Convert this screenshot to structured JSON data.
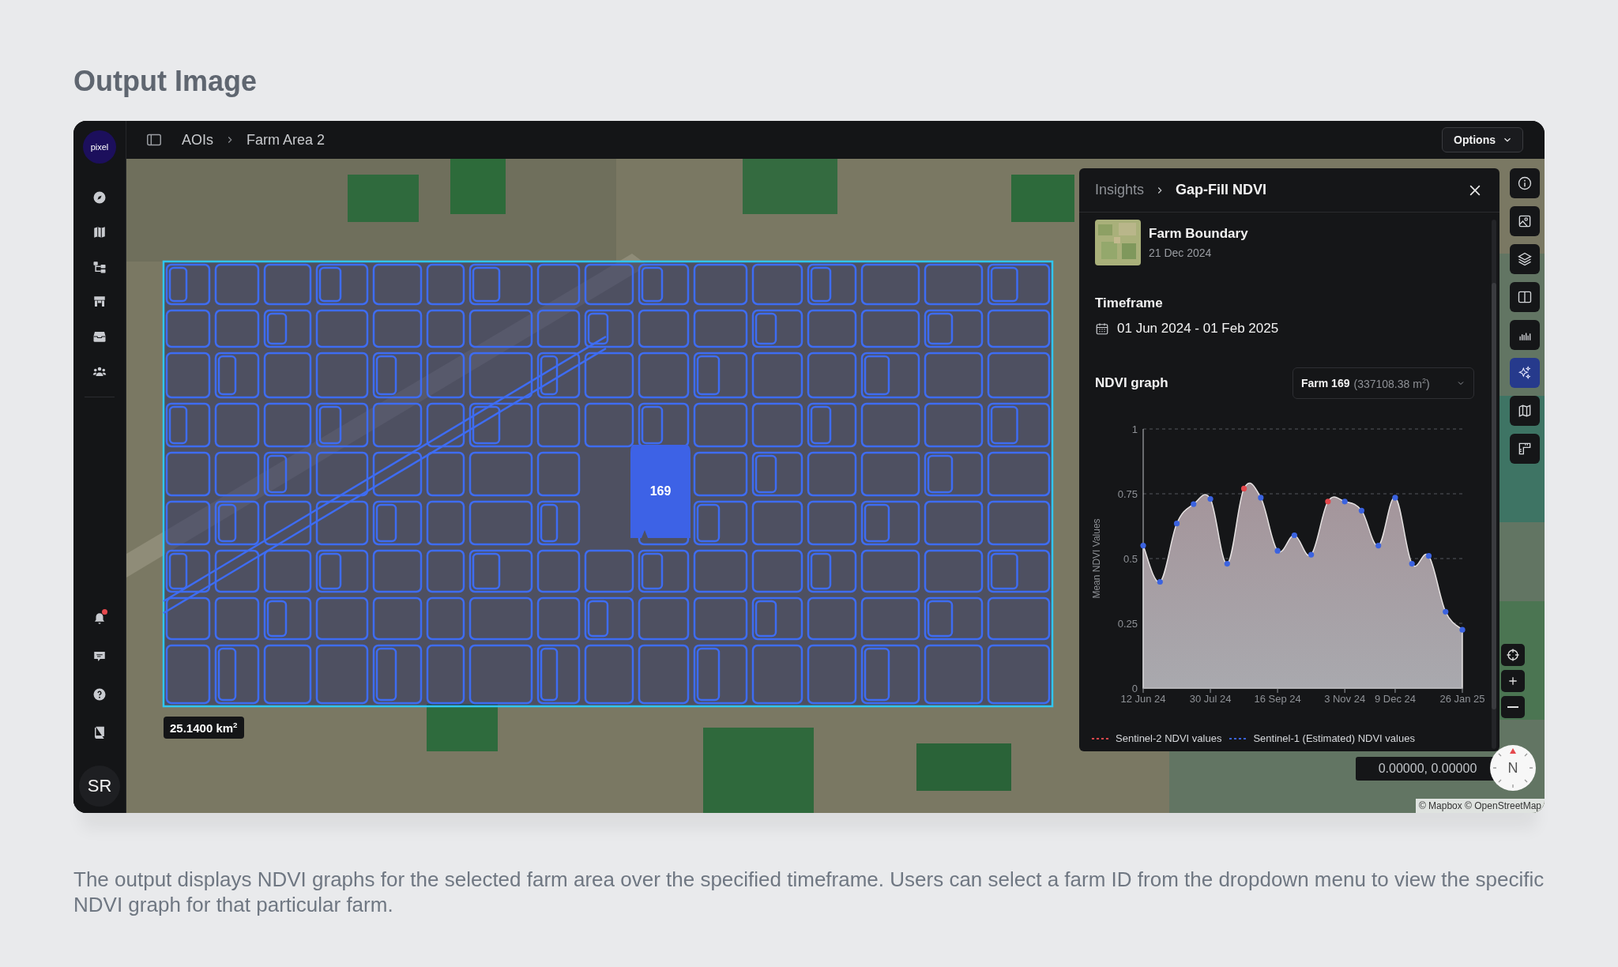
{
  "page": {
    "heading": "Output Image",
    "caption": "The output displays NDVI graphs for the selected farm area over the specified timeframe. Users can select a farm ID from the dropdown menu to view the specific NDVI graph for that particular farm."
  },
  "sidebar": {
    "logo": "pixel",
    "avatar": "SR",
    "notification_dot": true
  },
  "topbar": {
    "breadcrumb": [
      "AOIs",
      "Farm Area 2"
    ],
    "options_button": "Options"
  },
  "map": {
    "area_badge": "25.1400 km$^{2}$",
    "selected_field": "169",
    "coordinates": "0.00000, 0.00000",
    "compass": "N",
    "attribution": "© Mapbox © OpenStreetMap",
    "tools": [
      {
        "selected": false
      },
      {
        "selected": false
      },
      {
        "selected": false
      },
      {
        "selected": false
      },
      {
        "selected": false
      },
      {
        "selected": true
      },
      {
        "selected": false
      },
      {
        "selected": false
      }
    ]
  },
  "panel": {
    "breadcrumb": [
      "Insights",
      "Gap-Fill NDVI"
    ],
    "layer": {
      "title": "Farm Boundary",
      "date": "21 Dec 2024"
    },
    "timeframe_label": "Timeframe",
    "timeframe": "01 Jun 2024 - 01 Feb 2025",
    "graph_label": "NDVI graph",
    "farm_select": {
      "label": "Farm 169",
      "detail": "(337108.38 m$^{2}$)"
    },
    "chart_data": {
      "type": "area",
      "ylabel": "Mean NDVI Values",
      "categories": [
        "12 Jun 24",
        null,
        null,
        null,
        "30 Jul 24",
        null,
        null,
        null,
        "16 Sep 24",
        null,
        null,
        null,
        "3 Nov 24",
        null,
        null,
        "9 Dec 24",
        null,
        null,
        null,
        "26 Jan 25"
      ],
      "ylim": [
        0,
        1
      ],
      "yticks": [
        0,
        0.25,
        0.5,
        0.75,
        1
      ],
      "grid": true,
      "legend": "bottom",
      "series": [
        {
          "type": "area",
          "color": "#e6e2e2",
          "values": [
            0.55,
            0.41,
            0.635,
            0.71,
            0.73,
            0.48,
            0.77,
            0.735,
            0.53,
            0.59,
            0.515,
            0.72,
            0.72,
            0.685,
            0.55,
            0.735,
            0.48,
            0.51,
            0.295,
            0.225
          ]
        },
        {
          "name": "Sentinel-2 NDVI values",
          "type": "scatter",
          "color": "#e5484d",
          "values": [
            null,
            null,
            null,
            null,
            null,
            null,
            0.77,
            null,
            null,
            null,
            null,
            0.72,
            null,
            null,
            null,
            null,
            null,
            null,
            null,
            null
          ]
        },
        {
          "name": "Sentinel-1 (Estimated) NDVI values",
          "type": "scatter",
          "color": "#3b63e0",
          "values": [
            0.55,
            0.41,
            0.635,
            0.71,
            0.73,
            0.48,
            null,
            0.735,
            0.53,
            0.59,
            0.515,
            null,
            0.72,
            0.685,
            0.55,
            0.735,
            0.48,
            0.51,
            0.295,
            0.225
          ]
        }
      ]
    }
  }
}
